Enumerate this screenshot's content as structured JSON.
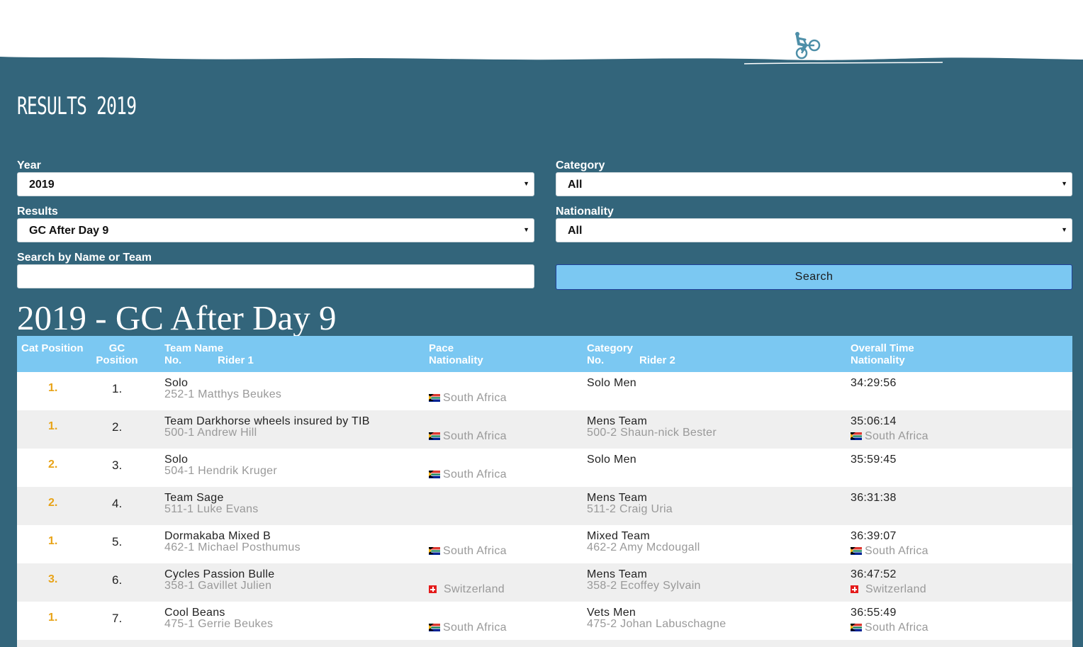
{
  "page": {
    "title": "RESULTS 2019",
    "brand_colors": {
      "background": "#33657b",
      "accent": "#7bc8f2",
      "position": "#e8a317"
    }
  },
  "header": {
    "logo_icon": "cyclist-icon"
  },
  "filters": {
    "year_label": "Year",
    "year_value": "2019",
    "category_label": "Category",
    "category_value": "All",
    "results_label": "Results",
    "results_value": "GC After Day 9",
    "nationality_label": "Nationality",
    "nationality_value": "All",
    "search_label": "Search by Name or Team",
    "search_value": "",
    "search_button": "Search"
  },
  "results": {
    "heading": "2019 - GC After Day 9",
    "columns": {
      "cat_position": "Cat Position",
      "gc": "GC",
      "gc_position": "Position",
      "team_name": "Team Name",
      "no": "No.",
      "rider1": "Rider 1",
      "pace": "Pace",
      "nationality": "Nationality",
      "category": "Category",
      "no2": "No.",
      "rider2": "Rider 2",
      "overall_time": "Overall Time",
      "nationality2": "Nationality"
    },
    "rows": [
      {
        "cat": "1.",
        "gc": "1.",
        "team": "Solo",
        "rider1": "252-1 Matthys Beukes",
        "nat1": "South Africa",
        "category": "Solo Men",
        "rider2": "",
        "time": "34:29:56",
        "nat2": ""
      },
      {
        "cat": "1.",
        "gc": "2.",
        "team": "Team Darkhorse wheels insured by TIB",
        "rider1": "500-1 Andrew Hill",
        "nat1": "South Africa",
        "category": "Mens Team",
        "rider2": "500-2 Shaun-nick Bester",
        "time": "35:06:14",
        "nat2": "South Africa"
      },
      {
        "cat": "2.",
        "gc": "3.",
        "team": "Solo",
        "rider1": "504-1 Hendrik Kruger",
        "nat1": "South Africa",
        "category": "Solo Men",
        "rider2": "",
        "time": "35:59:45",
        "nat2": ""
      },
      {
        "cat": "2.",
        "gc": "4.",
        "team": "Team Sage",
        "rider1": "511-1 Luke Evans",
        "nat1": "",
        "category": "Mens Team",
        "rider2": "511-2 Craig Uria",
        "time": "36:31:38",
        "nat2": ""
      },
      {
        "cat": "1.",
        "gc": "5.",
        "team": "Dormakaba Mixed B",
        "rider1": "462-1 Michael Posthumus",
        "nat1": "South Africa",
        "category": "Mixed Team",
        "rider2": "462-2 Amy Mcdougall",
        "time": "36:39:07",
        "nat2": "South Africa"
      },
      {
        "cat": "3.",
        "gc": "6.",
        "team": "Cycles Passion Bulle",
        "rider1": "358-1 Gavillet Julien",
        "nat1": "Switzerland",
        "category": "Mens Team",
        "rider2": "358-2 Ecoffey Sylvain",
        "time": "36:47:52",
        "nat2": "Switzerland"
      },
      {
        "cat": "1.",
        "gc": "7.",
        "team": "Cool Beans",
        "rider1": "475-1 Gerrie Beukes",
        "nat1": "South Africa",
        "category": "Vets Men",
        "rider2": "475-2 Johan Labuschagne",
        "time": "36:55:49",
        "nat2": "South Africa"
      }
    ]
  }
}
